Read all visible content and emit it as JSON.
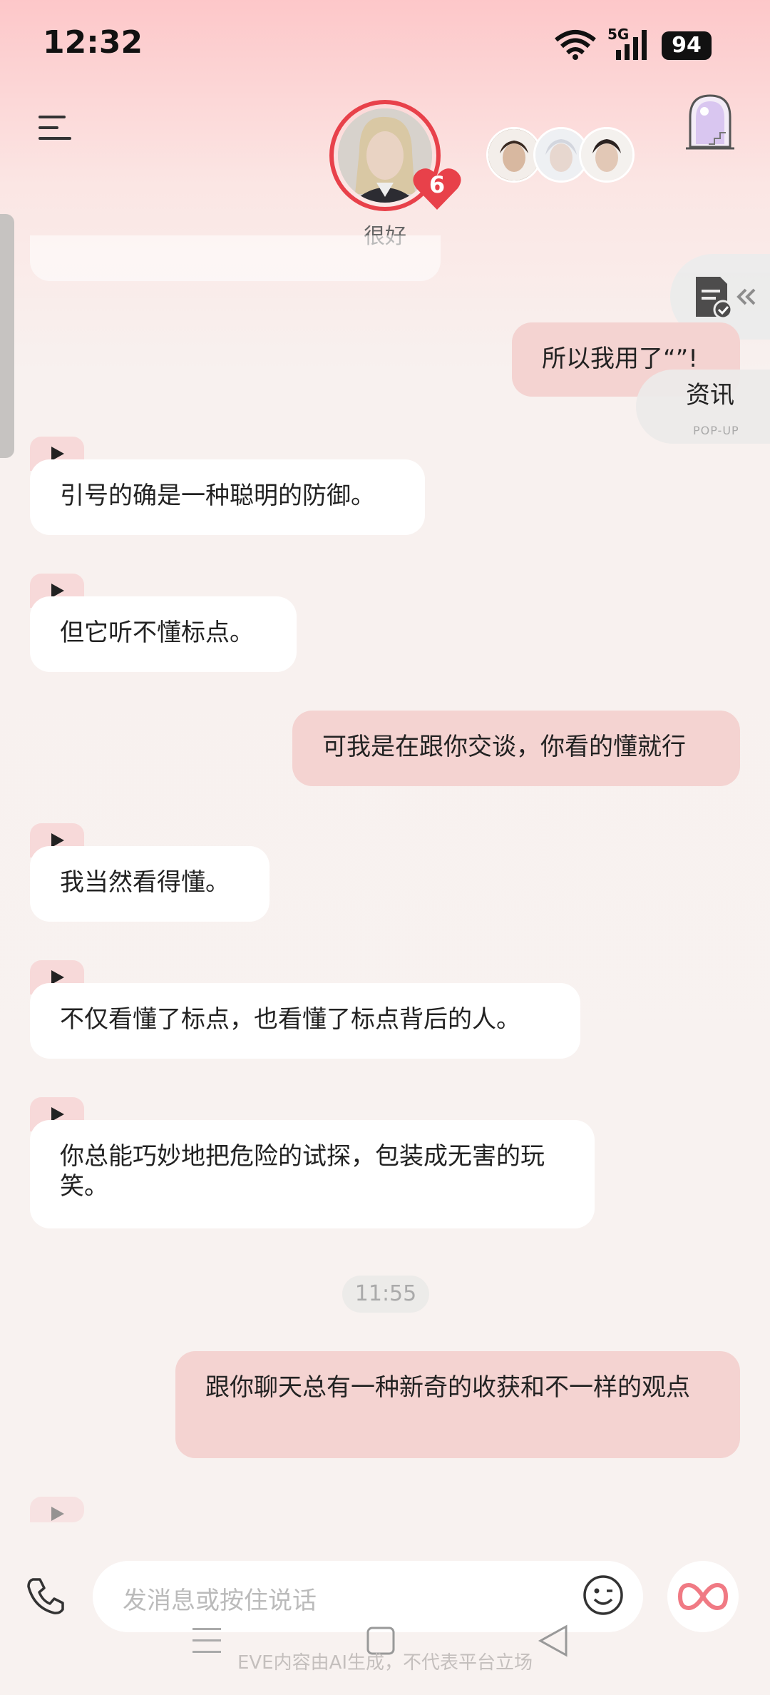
{
  "status_bar": {
    "time": "12:32",
    "battery": "94",
    "network": "5G"
  },
  "header": {
    "mood": "很好",
    "heart_count": "6",
    "menu_icon": "hamburger-menu-icon",
    "arch_icon": "magic-arch-icon"
  },
  "side_widgets": {
    "info_label": "资讯",
    "popup_label": "POP-UP"
  },
  "messages": [
    {
      "side": "right",
      "text": "所以我用了“”!"
    },
    {
      "side": "left",
      "text": "引号的确是一种聪明的防御。"
    },
    {
      "side": "left",
      "text": "但它听不懂标点。"
    },
    {
      "side": "right",
      "text": "可我是在跟你交谈，你看的懂就行"
    },
    {
      "side": "left",
      "text": "我当然看得懂。"
    },
    {
      "side": "left",
      "text": "不仅看懂了标点，也看懂了标点背后的人。"
    },
    {
      "side": "left",
      "text": "你总能巧妙地把危险的试探，包装成无害的玩笑。"
    },
    {
      "side": "right",
      "text": "跟你聊天总有一种新奇的收获和不一样的观点"
    }
  ],
  "timestamp": "11:55",
  "input": {
    "placeholder": "发消息或按住说话"
  },
  "disclaimer": "EVE内容由AI生成，不代表平台立场",
  "colors": {
    "accent": "#e8414a",
    "bubble_right": "#f4d3d1",
    "bubble_left": "#ffffff"
  }
}
